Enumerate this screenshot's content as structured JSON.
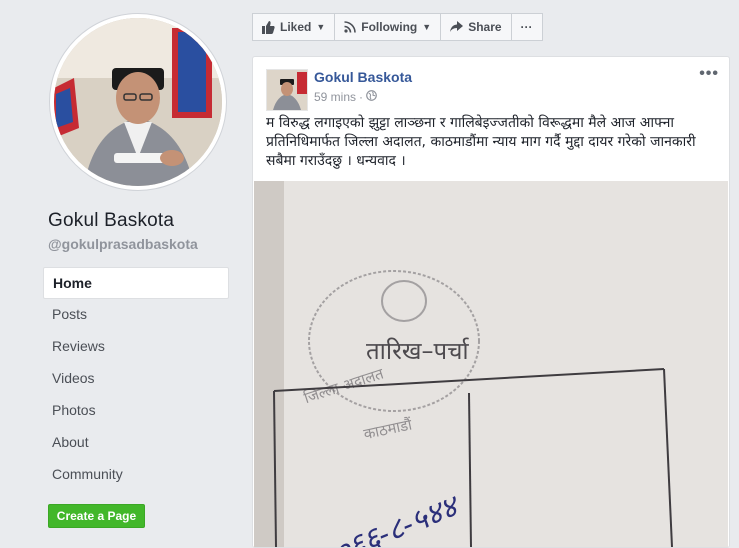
{
  "sidebar": {
    "page_name": "Gokul Baskota",
    "handle": "@gokulprasadbaskota",
    "nav_items": [
      {
        "label": "Home",
        "active": true
      },
      {
        "label": "Posts"
      },
      {
        "label": "Reviews"
      },
      {
        "label": "Videos"
      },
      {
        "label": "Photos"
      },
      {
        "label": "About"
      },
      {
        "label": "Community"
      }
    ],
    "create_page_label": "Create a Page"
  },
  "action_bar": {
    "liked_label": "Liked",
    "following_label": "Following",
    "share_label": "Share",
    "more_label": "···"
  },
  "post": {
    "author": "Gokul Baskota",
    "timestamp": "59 mins",
    "more_label": "•••",
    "text": "म विरुद्ध लगाइएको झुट्टा लाञ्छना र गालिबेइज्जतीको विरूद्धमा मैले आज आफ्ना प्रतिनिधिमार्फत जिल्ला अदालत, काठमाडौंमा न्याय माग गर्दै मुद्दा दायर गरेको जानकारी सबैमा गराउँदछु । धन्यवाद ।",
    "photo_texts": {
      "stamp_title": "तारिख–पर्चा",
      "stamp_court": "जिल्ला अदालत",
      "stamp_place": "काठमाडौं",
      "handwritten_number": "०६६-८-५४४"
    }
  },
  "colors": {
    "link_blue": "#365899",
    "page_bg": "#e9ebee",
    "green": "#42b72a"
  }
}
